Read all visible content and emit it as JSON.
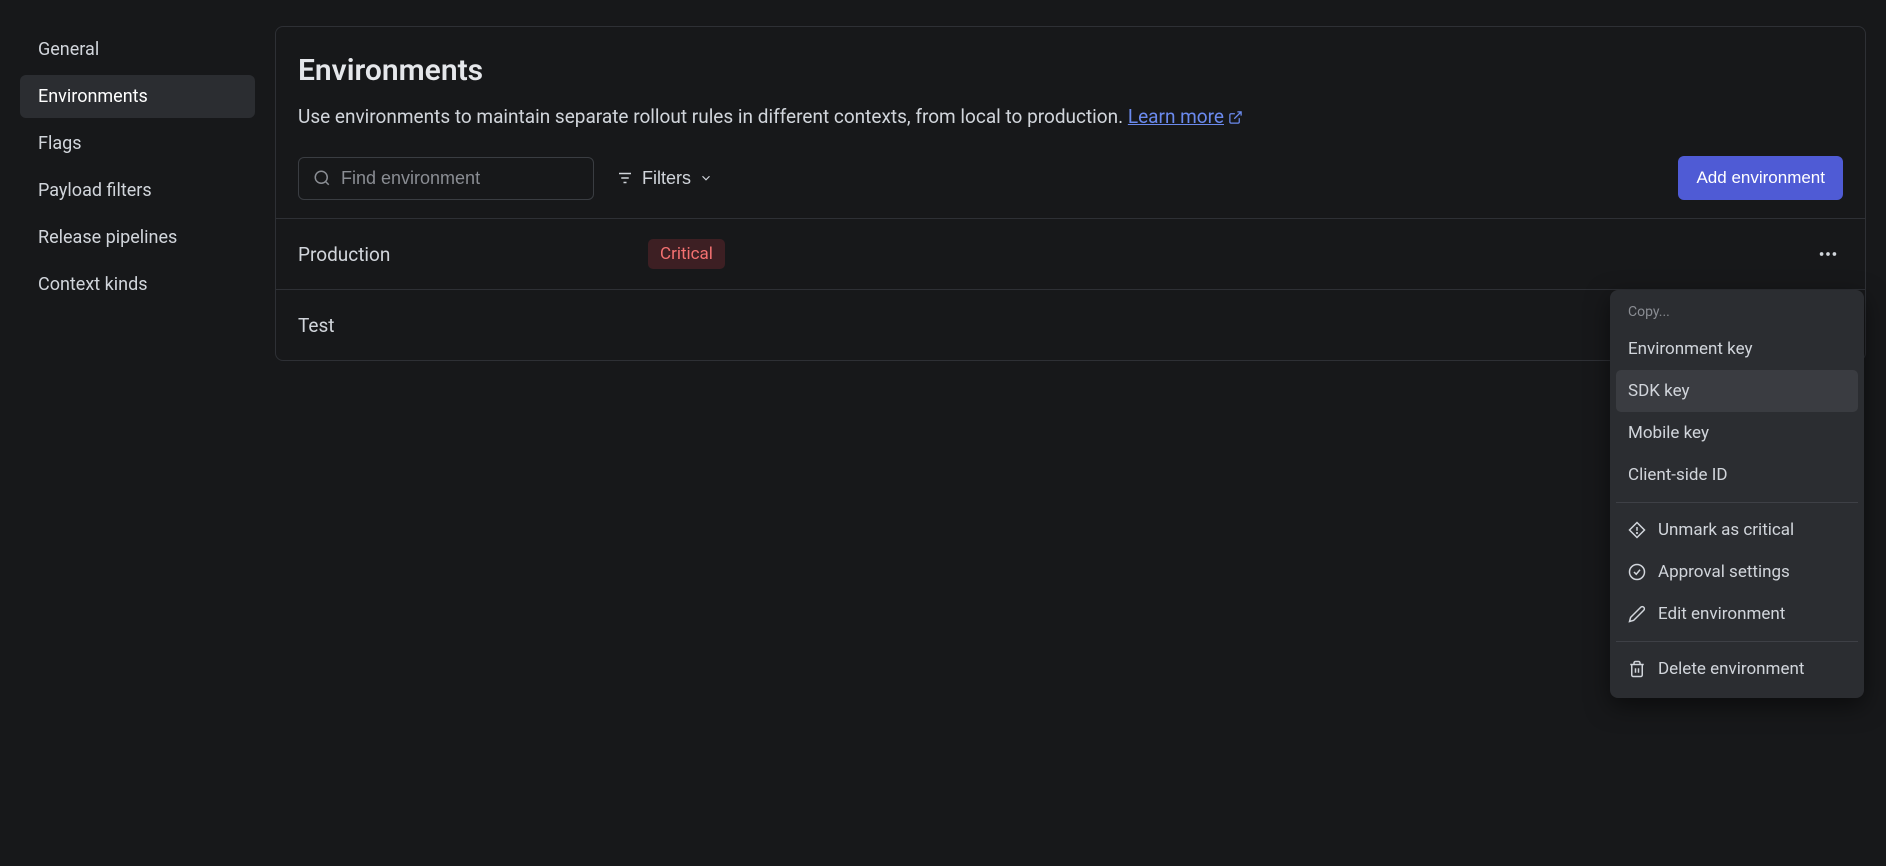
{
  "sidebar": {
    "items": [
      {
        "label": "General"
      },
      {
        "label": "Environments"
      },
      {
        "label": "Flags"
      },
      {
        "label": "Payload filters"
      },
      {
        "label": "Release pipelines"
      },
      {
        "label": "Context kinds"
      }
    ]
  },
  "header": {
    "title": "Environments",
    "description": "Use environments to maintain separate rollout rules in different contexts, from local to production. ",
    "learn_more": "Learn more"
  },
  "toolbar": {
    "search_placeholder": "Find environment",
    "filters_label": "Filters",
    "add_label": "Add environment"
  },
  "environments": [
    {
      "name": "Production",
      "badge": "Critical"
    },
    {
      "name": "Test",
      "badge": null
    }
  ],
  "context_menu": {
    "header": "Copy...",
    "copy_items": [
      {
        "label": "Environment key"
      },
      {
        "label": "SDK key"
      },
      {
        "label": "Mobile key"
      },
      {
        "label": "Client-side ID"
      }
    ],
    "actions": [
      {
        "label": "Unmark as critical"
      },
      {
        "label": "Approval settings"
      },
      {
        "label": "Edit environment"
      }
    ],
    "delete": {
      "label": "Delete environment"
    }
  }
}
